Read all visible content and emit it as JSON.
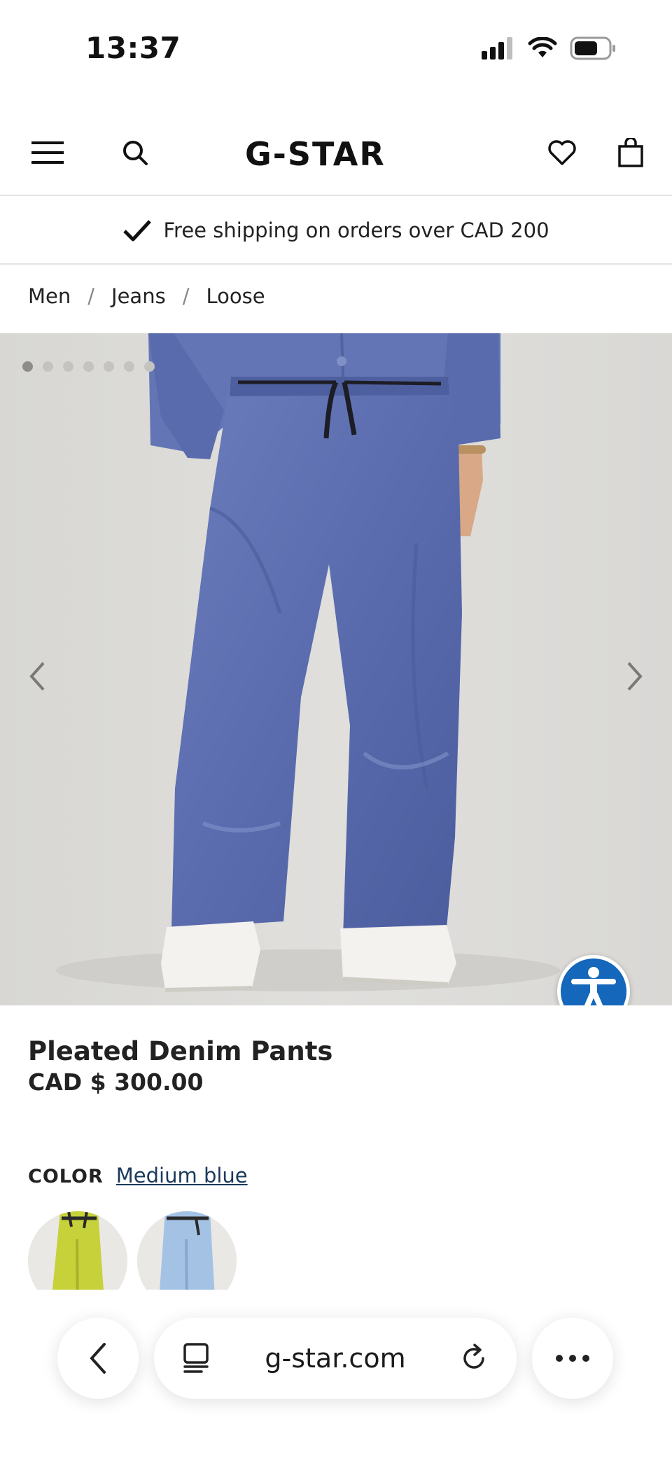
{
  "status_bar": {
    "time": "13:37"
  },
  "header": {
    "logo_text": "G-STAR"
  },
  "shipping_banner": {
    "text": "Free shipping on orders over CAD 200"
  },
  "breadcrumb": [
    "Men",
    "Jeans",
    "Loose"
  ],
  "breadcrumb_separator": "/",
  "gallery": {
    "dot_count": 7,
    "active_index": 0
  },
  "product": {
    "name": "Pleated Denim Pants",
    "price": "CAD $ 300.00",
    "color_label": "COLOR",
    "color_value": "Medium blue"
  },
  "browser": {
    "url": "g-star.com"
  },
  "colors": {
    "accessibility_blue": "#1467ba",
    "denim": "#5c6fb0"
  }
}
